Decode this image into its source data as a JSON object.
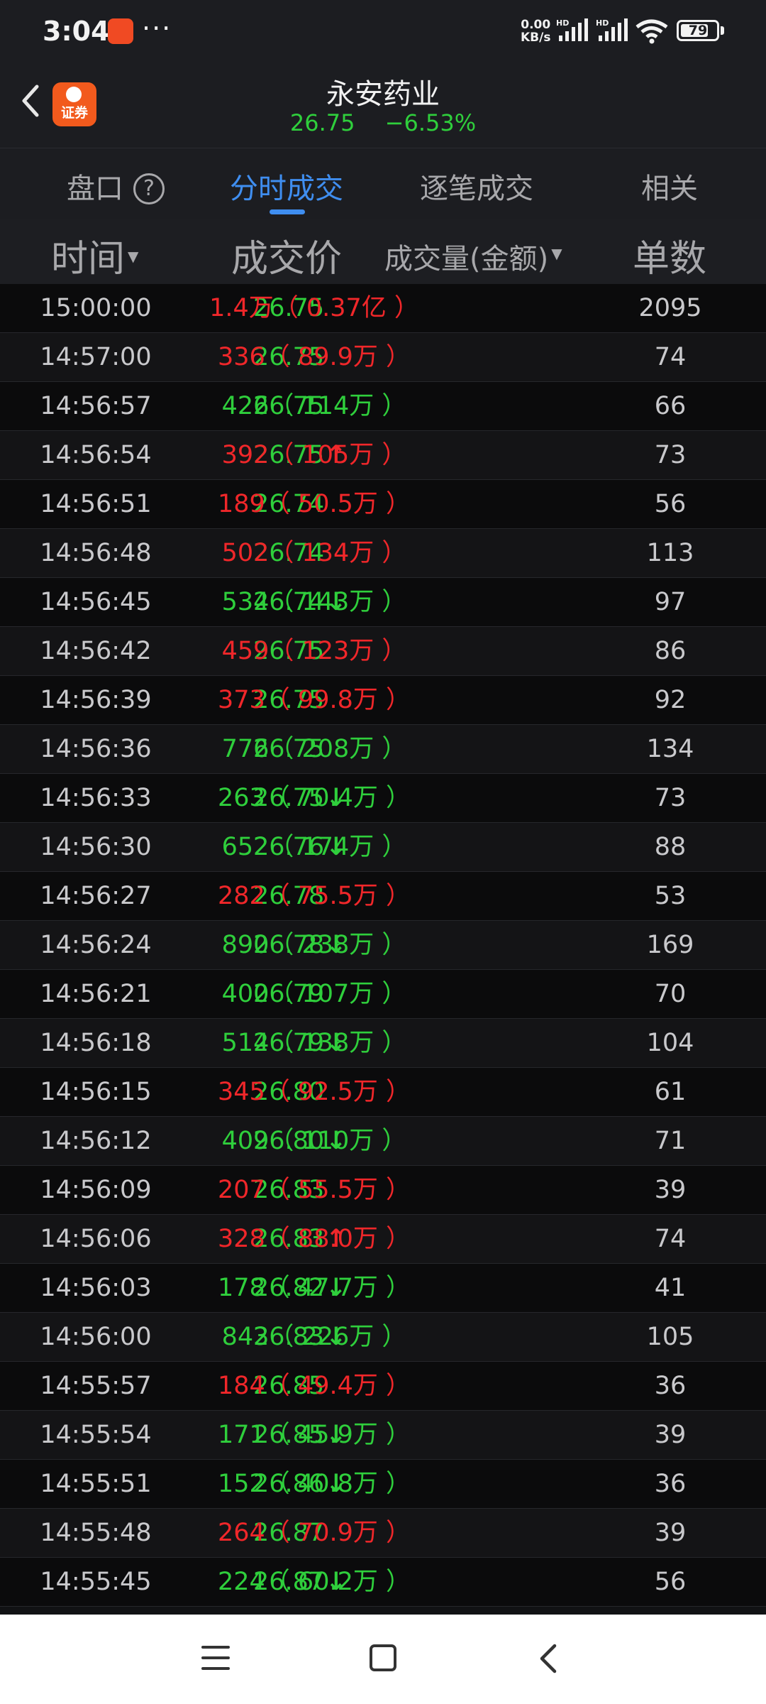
{
  "status_bar": {
    "time": "3:04",
    "dots": "···",
    "net_speed_value": "0.00",
    "net_speed_unit": "KB/s",
    "battery": "79",
    "battery_level": 0.79,
    "icons": [
      "app-notification-icon",
      "signal-hd-icon",
      "signal-hd-icon",
      "wifi-icon",
      "battery-icon"
    ]
  },
  "header": {
    "stock_name": "永安药业",
    "price": "26.75",
    "change": "−6.53%",
    "logo_text": "证券",
    "back_icon": "chevron-left-icon"
  },
  "tabs": [
    {
      "label": "盘口",
      "active": false
    },
    {
      "label": "分时成交",
      "active": true
    },
    {
      "label": "逐笔成交",
      "active": false
    },
    {
      "label": "相关",
      "active": false
    }
  ],
  "help_icon": "?",
  "columns": {
    "time": "时间",
    "price": "成交价",
    "volume": "成交量(金额)",
    "count": "单数"
  },
  "colors": {
    "green": "#2fcf3c",
    "red": "#f0272a",
    "accent": "#3f8ef0",
    "background": "#111214"
  },
  "trades": [
    {
      "time": "15:00:00",
      "price": "26.75",
      "arrow": "",
      "volume": "1.4万（ 0.37亿 ）",
      "vol_color": "red",
      "count": "2095"
    },
    {
      "time": "14:57:00",
      "price": "26.75",
      "arrow": "",
      "volume": "336（ 89.9万 ）",
      "vol_color": "red",
      "count": "74"
    },
    {
      "time": "14:56:57",
      "price": "26.75",
      "arrow": "",
      "volume": "426（ 114万 ）",
      "vol_color": "green",
      "count": "66"
    },
    {
      "time": "14:56:54",
      "price": "26.75",
      "arrow": "↑",
      "volume": "392（ 105万 ）",
      "vol_color": "red",
      "count": "73"
    },
    {
      "time": "14:56:51",
      "price": "26.74",
      "arrow": "",
      "volume": "189（ 50.5万 ）",
      "vol_color": "red",
      "count": "56"
    },
    {
      "time": "14:56:48",
      "price": "26.74",
      "arrow": "",
      "volume": "502（ 134万 ）",
      "vol_color": "red",
      "count": "113"
    },
    {
      "time": "14:56:45",
      "price": "26.74",
      "arrow": "↓",
      "volume": "534（ 143万 ）",
      "vol_color": "green",
      "count": "97"
    },
    {
      "time": "14:56:42",
      "price": "26.75",
      "arrow": "",
      "volume": "459（ 123万 ）",
      "vol_color": "red",
      "count": "86"
    },
    {
      "time": "14:56:39",
      "price": "26.75",
      "arrow": "",
      "volume": "373（ 99.8万 ）",
      "vol_color": "red",
      "count": "92"
    },
    {
      "time": "14:56:36",
      "price": "26.75",
      "arrow": "",
      "volume": "776（ 208万 ）",
      "vol_color": "green",
      "count": "134"
    },
    {
      "time": "14:56:33",
      "price": "26.75",
      "arrow": "↓",
      "volume": "263（ 70.4万 ）",
      "vol_color": "green",
      "count": "73"
    },
    {
      "time": "14:56:30",
      "price": "26.76",
      "arrow": "↓",
      "volume": "652（ 174万 ）",
      "vol_color": "green",
      "count": "88"
    },
    {
      "time": "14:56:27",
      "price": "26.78",
      "arrow": "",
      "volume": "282（ 75.5万 ）",
      "vol_color": "red",
      "count": "53"
    },
    {
      "time": "14:56:24",
      "price": "26.78",
      "arrow": "↓",
      "volume": "890（ 238万 ）",
      "vol_color": "green",
      "count": "169"
    },
    {
      "time": "14:56:21",
      "price": "26.79",
      "arrow": "",
      "volume": "400（ 107万 ）",
      "vol_color": "green",
      "count": "70"
    },
    {
      "time": "14:56:18",
      "price": "26.79",
      "arrow": "↓",
      "volume": "514（ 138万 ）",
      "vol_color": "green",
      "count": "104"
    },
    {
      "time": "14:56:15",
      "price": "26.80",
      "arrow": "",
      "volume": "345（ 92.5万 ）",
      "vol_color": "red",
      "count": "61"
    },
    {
      "time": "14:56:12",
      "price": "26.80",
      "arrow": "↓",
      "volume": "409（ 110万 ）",
      "vol_color": "green",
      "count": "71"
    },
    {
      "time": "14:56:09",
      "price": "26.83",
      "arrow": "",
      "volume": "207（ 55.5万 ）",
      "vol_color": "red",
      "count": "39"
    },
    {
      "time": "14:56:06",
      "price": "26.83",
      "arrow": "↑",
      "volume": "328（ 88.0万 ）",
      "vol_color": "red",
      "count": "74"
    },
    {
      "time": "14:56:03",
      "price": "26.82",
      "arrow": "↓",
      "volume": "178（ 47.7万 ）",
      "vol_color": "green",
      "count": "41"
    },
    {
      "time": "14:56:00",
      "price": "26.83",
      "arrow": "↓",
      "volume": "843（ 226万 ）",
      "vol_color": "green",
      "count": "105"
    },
    {
      "time": "14:55:57",
      "price": "26.85",
      "arrow": "",
      "volume": "184（ 49.4万 ）",
      "vol_color": "red",
      "count": "36"
    },
    {
      "time": "14:55:54",
      "price": "26.85",
      "arrow": "↓",
      "volume": "171（ 45.9万 ）",
      "vol_color": "green",
      "count": "39"
    },
    {
      "time": "14:55:51",
      "price": "26.86",
      "arrow": "↓",
      "volume": "152（ 40.8万 ）",
      "vol_color": "green",
      "count": "36"
    },
    {
      "time": "14:55:48",
      "price": "26.87",
      "arrow": "",
      "volume": "264（ 70.9万 ）",
      "vol_color": "red",
      "count": "39"
    },
    {
      "time": "14:55:45",
      "price": "26.87",
      "arrow": "↓",
      "volume": "224（ 60.2万 ）",
      "vol_color": "green",
      "count": "56"
    }
  ],
  "navbar": {
    "icons": [
      "menu-icon",
      "home-icon",
      "back-icon"
    ]
  }
}
